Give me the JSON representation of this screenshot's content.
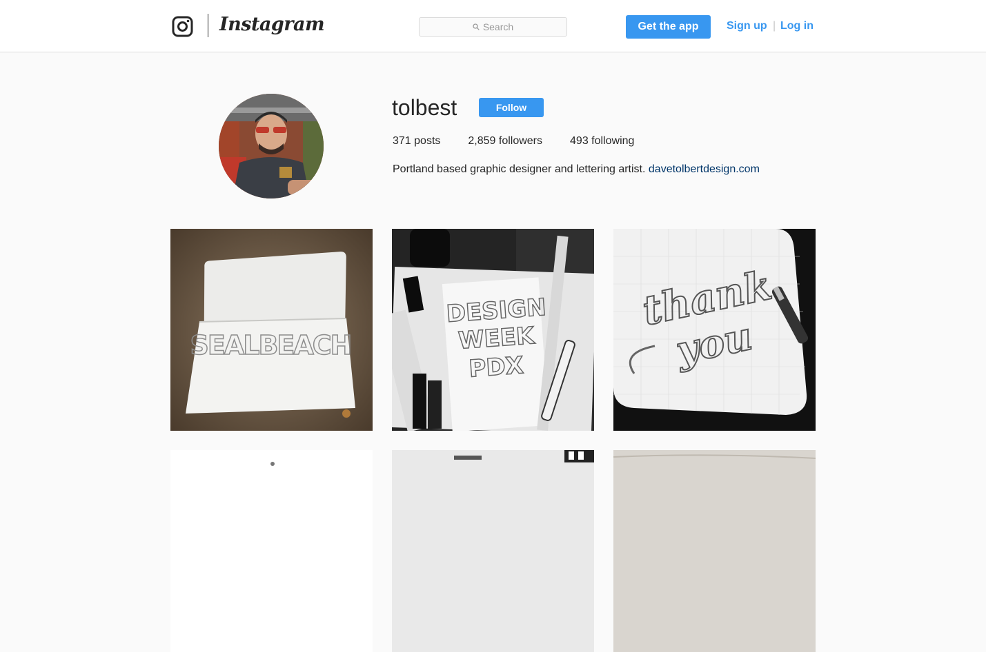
{
  "header": {
    "logo_text": "Instagram",
    "search_placeholder": "Search",
    "get_app_label": "Get the app",
    "signup_label": "Sign up",
    "separator": "|",
    "login_label": "Log in",
    "accent_color": "#3897f0"
  },
  "profile": {
    "username": "tolbest",
    "follow_label": "Follow",
    "stats": {
      "posts": "371 posts",
      "followers": "2,859 followers",
      "following": "493 following"
    },
    "bio_text": "Portland based graphic designer and lettering artist.",
    "bio_link": "davetolbertdesign.com"
  },
  "posts": [
    {
      "lettering": "SEALBEACH"
    },
    {
      "lettering_lines": [
        "DESIGN",
        "WEEK",
        "PDX"
      ]
    },
    {
      "lettering_lines": [
        "thank",
        "you"
      ]
    },
    {},
    {},
    {}
  ]
}
